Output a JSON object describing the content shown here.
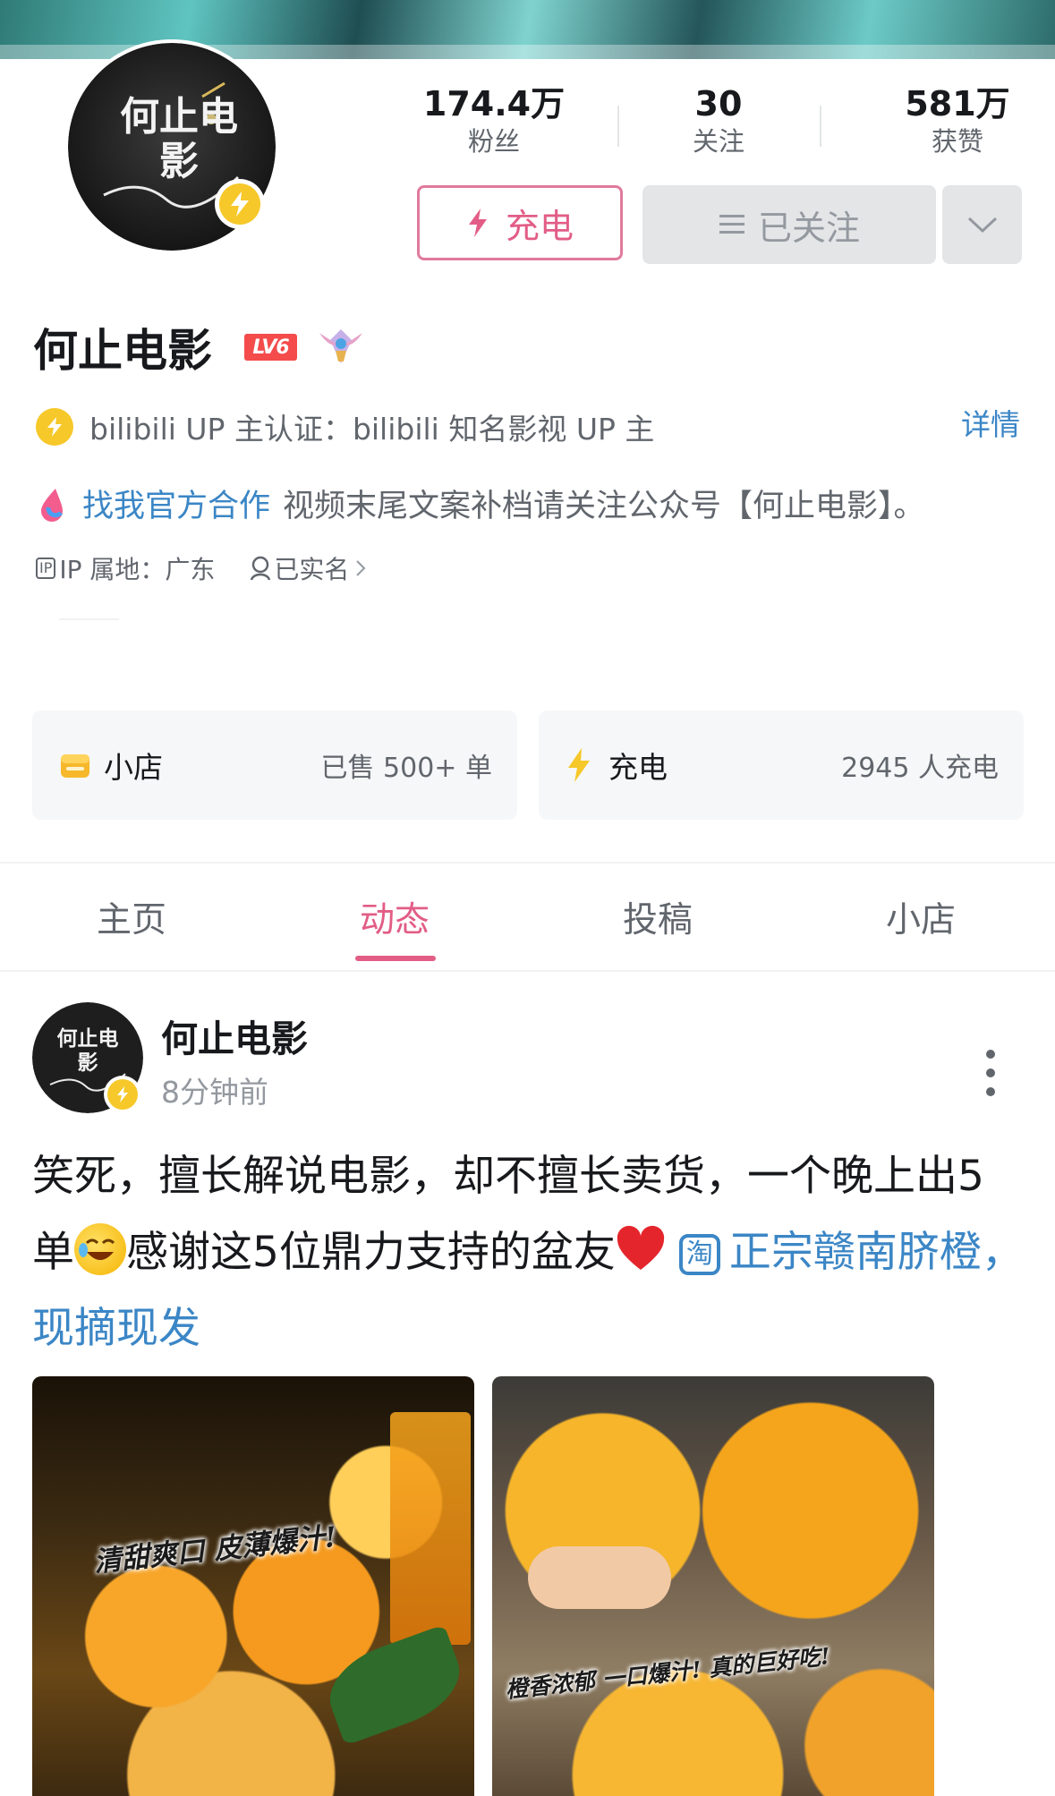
{
  "profile": {
    "name": "何止电影",
    "avatar_text": "何止电影",
    "level_badge": "LV6",
    "stats": [
      {
        "value": "174.4万",
        "label": "粉丝"
      },
      {
        "value": "30",
        "label": "关注"
      },
      {
        "value": "581万",
        "label": "获赞"
      }
    ],
    "charge_button": "充电",
    "followed_button": "已关注",
    "verification": "bilibili UP 主认证：bilibili 知名影视 UP 主",
    "details_link": "详情",
    "cooperation_link": "找我官方合作",
    "signature": "视频末尾文案补档请关注公众号【何止电影】。",
    "ip_badge": "IP",
    "ip_location": "IP 属地：广东",
    "real_name": "已实名"
  },
  "cards": {
    "shop": {
      "label": "小店",
      "value": "已售 500+ 单"
    },
    "charge": {
      "label": "充电",
      "value": "2945 人充电"
    }
  },
  "tabs": [
    {
      "label": "主页"
    },
    {
      "label": "动态"
    },
    {
      "label": "投稿"
    },
    {
      "label": "小店"
    }
  ],
  "active_tab": "动态",
  "post": {
    "author": "何止电影",
    "time": "8分钟前",
    "text_part1": "笑死，擅长解说电影，却不擅长卖货，一个晚上出5单",
    "text_part2": "感谢这5位鼎力支持的盆友",
    "taobao_icon": "淘",
    "product_link": "正宗赣南脐橙，现摘现发",
    "image1_caption": "清甜爽口 皮薄爆汁!",
    "image2_caption": "橙香浓郁 一口爆汁! 真的巨好吃!"
  },
  "colors": {
    "accent_pink": "#e25d86",
    "link_blue": "#3b86c6",
    "bolt_yellow": "#f6c829"
  }
}
